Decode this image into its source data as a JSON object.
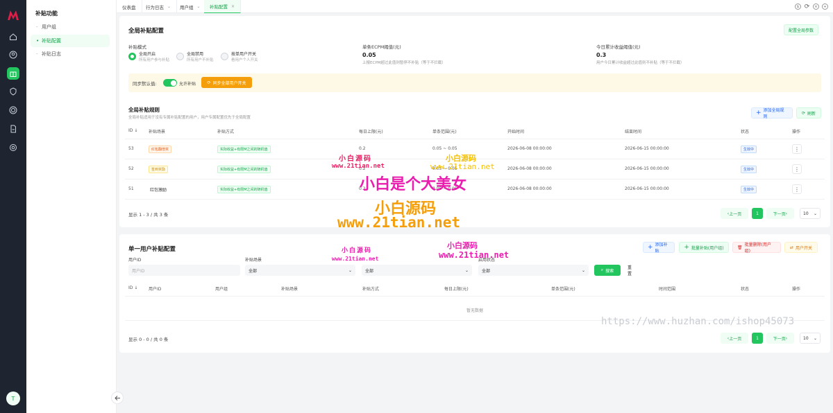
{
  "sidebar": {
    "title": "补贴功能",
    "items": [
      {
        "label": "用户组"
      },
      {
        "label": "补贴配置"
      },
      {
        "label": "补贴日志"
      }
    ],
    "avatar_letter": "T"
  },
  "tabs": [
    {
      "label": "仪表盘",
      "closable": false
    },
    {
      "label": "行为日志",
      "closable": true
    },
    {
      "label": "用户组",
      "closable": true
    },
    {
      "label": "补贴配置",
      "closable": true,
      "active": true
    }
  ],
  "global_config": {
    "title": "全局补贴配置",
    "configure_button": "配置全局参数",
    "mode_label": "补贴模式",
    "modes": [
      {
        "title": "全局开启",
        "desc": "所有用户参与补贴"
      },
      {
        "title": "全局禁用",
        "desc": "所有用户不补贴"
      },
      {
        "title": "按单用户开关",
        "desc": "看用户个人开关"
      }
    ],
    "ecpm_label": "单条ECPM阈值(元)",
    "ecpm_value": "0.05",
    "ecpm_desc": "上报ECPM超过此值则暂停不补贴（等于不拦截）",
    "daily_label": "今日累计收益阈值(元)",
    "daily_value": "0.3",
    "daily_desc": "用户今日累计收益超过此值则不补贴（等于不拦截）",
    "sync_label": "同步默认值:",
    "sync_toggle_text": "允许补贴",
    "sync_button": "同步全部用户开关"
  },
  "global_rules": {
    "title": "全局补贴规则",
    "desc": "全局补贴适用于没有专属补贴配置的用户，用户专属配置优先于全局配置",
    "add_button": "添加全局规则",
    "refresh_button": "刷新",
    "columns": [
      "ID",
      "补贴场景",
      "补贴方式",
      "每日上限(元)",
      "单条范围(元)",
      "开始时间",
      "结束时间",
      "状态",
      "操作"
    ],
    "rows": [
      {
        "id": "53",
        "scene": "红包翻倍奖",
        "scene_style": "orange",
        "method": "实际收益+有限M之间的随机值",
        "daily": "0.2",
        "range": "0.05 ~ 0.05",
        "start": "2026-06-08 00:00:00",
        "end": "2026-06-15 00:00:00",
        "status": "生效中"
      },
      {
        "id": "52",
        "scene": "签到奖励",
        "scene_style": "yellow",
        "method": "实际收益+有限M之间的随机值",
        "daily": "0.2",
        "range": "0.05 ~ 0.05",
        "start": "2026-06-08 00:00:00",
        "end": "2026-06-15 00:00:00",
        "status": "生效中"
      },
      {
        "id": "51",
        "scene": "红包激励",
        "scene_style": "plain",
        "method": "实际收益+有限M之间的随机值",
        "daily": "0.2",
        "range": "0.05 ~ 0.05",
        "start": "2026-06-08 00:00:00",
        "end": "2026-06-15 00:00:00",
        "status": "生效中"
      }
    ],
    "summary": "显示 1 - 3 / 共 3 条",
    "prev": "上一页",
    "next": "下一页",
    "page": "1",
    "page_size": "10"
  },
  "user_config": {
    "title": "单一用户补贴配置",
    "buttons": {
      "add": "添加补贴",
      "batch_add": "批量补贴(用户组)",
      "batch_delete": "批量删除(用户组)",
      "user_switch": "用户开关"
    },
    "filters": {
      "user_id_label": "用户ID",
      "user_id_placeholder": "用户ID",
      "scene_label": "补贴场景",
      "scene_value": "全部",
      "method_value": "全部",
      "status_label": "启用状态",
      "status_value": "全部",
      "search": "搜索",
      "reset": "重置"
    },
    "columns": [
      "ID",
      "用户ID",
      "用户组",
      "补贴场景",
      "补贴方式",
      "每日上限(元)",
      "单条范围(元)",
      "时间范围",
      "状态",
      "操作"
    ],
    "empty": "暂无数据",
    "summary": "显示 0 - 0 / 共 0 条",
    "prev": "上一页",
    "next": "下一页",
    "page": "1",
    "page_size": "10"
  },
  "watermarks": {
    "wm1": "小白源码",
    "wm2": "www.21tian.net",
    "wm3": "小白源码",
    "wm4": "www.21tian.net",
    "big_title": "小白是个大美女",
    "big_brand": "小白源码",
    "big_url": "www.21tian.net",
    "wm5": "小白源码",
    "wm6": "www.21tian.net",
    "wm7": "小白源码",
    "wm8": "www.21tian.net",
    "huzhan": "https://www.huzhan.com/ishop45073"
  },
  "colors": {
    "accent": "#22c55e",
    "rail": "#1f2530",
    "watermark_magenta": "#e91eae",
    "watermark_orange": "#f59e0b"
  }
}
